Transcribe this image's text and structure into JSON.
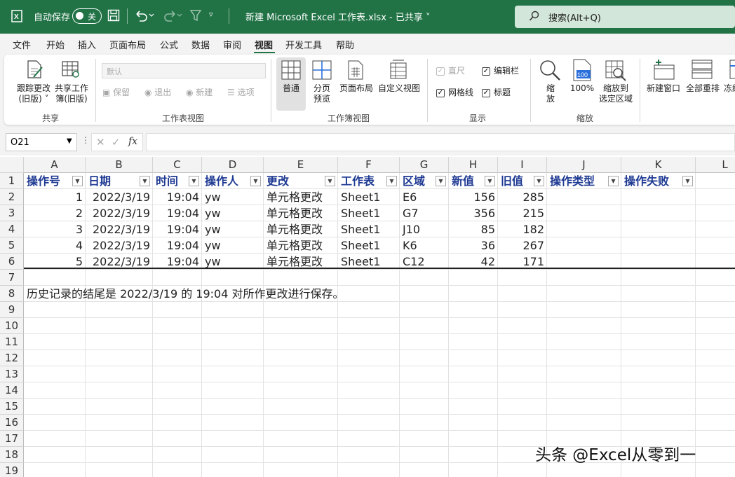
{
  "titlebar": {
    "autosave_label": "自动保存",
    "autosave_state": "关",
    "document_title": "新建 Microsoft Excel 工作表.xlsx  -  已共享  ˅",
    "search_placeholder": "搜索(Alt+Q)"
  },
  "menu": {
    "tabs": [
      "文件",
      "开始",
      "插入",
      "页面布局",
      "公式",
      "数据",
      "审阅",
      "视图",
      "开发工具",
      "帮助"
    ],
    "active": "视图"
  },
  "ribbon": {
    "share": {
      "track_changes": "跟踪更改",
      "track_changes_sub": "(旧版) ˅",
      "share_workbook": "共享工作",
      "share_workbook_sub": "簿(旧版)",
      "group": "共享"
    },
    "sheetview": {
      "dropdown": "默认",
      "keep": "保留",
      "exit": "退出",
      "new": "新建",
      "options": "选项",
      "group": "工作表视图"
    },
    "workbookview": {
      "normal": "普通",
      "pagebreak": "分页",
      "pagebreak_sub": "预览",
      "pagelayout": "页面布局",
      "custom": "自定义视图",
      "group": "工作簿视图"
    },
    "show": {
      "ruler": "直尺",
      "formula_bar": "编辑栏",
      "gridlines": "网格线",
      "headings": "标题",
      "group": "显示"
    },
    "zoom": {
      "zoom": "缩",
      "zoom_sub": "放",
      "hundred": "100%",
      "to_selection": "缩放到",
      "to_selection_sub": "选定区域",
      "group": "缩放"
    },
    "window": {
      "new_window": "新建窗口",
      "arrange": "全部重排",
      "freeze": "冻结"
    }
  },
  "formula_bar": {
    "name_box": "O21",
    "fx": "fx",
    "value": ""
  },
  "sheet": {
    "columns": [
      "A",
      "B",
      "C",
      "D",
      "E",
      "F",
      "G",
      "H",
      "I",
      "J",
      "K",
      "L"
    ],
    "rows": [
      "1",
      "2",
      "3",
      "4",
      "5",
      "6",
      "7",
      "8",
      "9",
      "10",
      "11",
      "12",
      "13",
      "14",
      "15",
      "16",
      "17",
      "18",
      "19"
    ],
    "headers": [
      "操作号",
      "日期",
      "时间",
      "操作人",
      "更改",
      "工作表",
      "区域",
      "新值",
      "旧值",
      "操作类型",
      "操作失败"
    ],
    "data": [
      [
        "1",
        "2022/3/19",
        "19:04",
        "yw",
        "单元格更改",
        "Sheet1",
        "E6",
        "156",
        "285"
      ],
      [
        "2",
        "2022/3/19",
        "19:04",
        "yw",
        "单元格更改",
        "Sheet1",
        "G7",
        "356",
        "215"
      ],
      [
        "3",
        "2022/3/19",
        "19:04",
        "yw",
        "单元格更改",
        "Sheet1",
        "J10",
        "85",
        "182"
      ],
      [
        "4",
        "2022/3/19",
        "19:04",
        "yw",
        "单元格更改",
        "Sheet1",
        "K6",
        "36",
        "267"
      ],
      [
        "5",
        "2022/3/19",
        "19:04",
        "yw",
        "单元格更改",
        "Sheet1",
        "C12",
        "42",
        "171"
      ]
    ],
    "note": "历史记录的结尾是 2022/3/19 的 19:04 对所作更改进行保存。"
  },
  "watermark": "头条 @Excel从零到一",
  "colors": {
    "title_bg": "#217346",
    "header_text": "#1f3a93"
  }
}
